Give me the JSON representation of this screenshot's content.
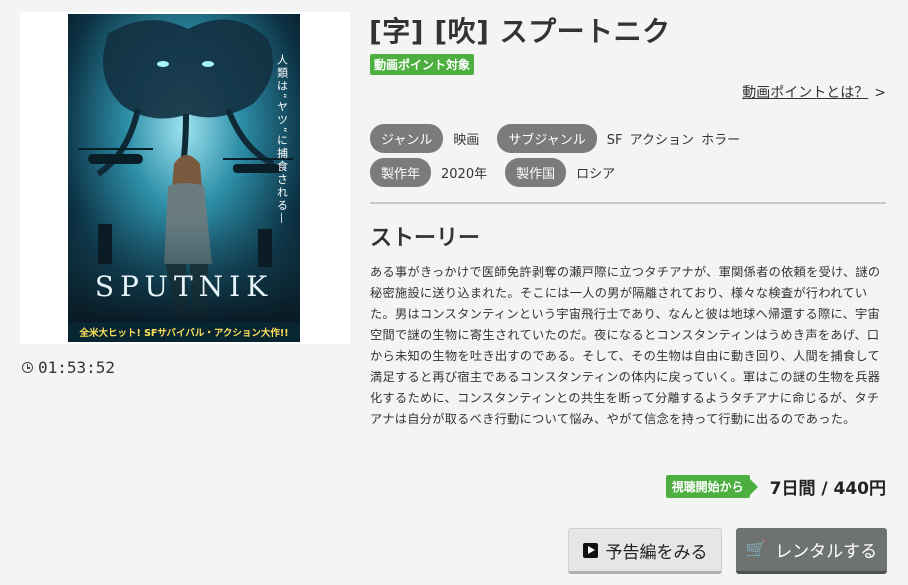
{
  "title": "[字] [吹] スプートニク",
  "point_badge": "動画ポイント対象",
  "point_link": {
    "label": "動画ポイントとは？",
    "chevron": ">"
  },
  "poster": {
    "taglines": [
      "人類は“ヤツ”に捕食される—"
    ],
    "logo": "SPUTNIK",
    "banner": "全米大ヒット! SFサバイバル・アクション大作!!"
  },
  "duration": "01:53:52",
  "meta": {
    "genre_label": "ジャンル",
    "genre_value": "映画",
    "subgenre_label": "サブジャンル",
    "subgenre_value": "SF アクション ホラー",
    "year_label": "製作年",
    "year_value": "2020年",
    "country_label": "製作国",
    "country_value": "ロシア"
  },
  "story": {
    "heading": "ストーリー",
    "text": "ある事がきっかけで医師免許剥奪の瀬戸際に立つタチアナが、軍関係者の依頼を受け、謎の秘密施設に送り込まれた。そこには一人の男が隔離されており、様々な検査が行われていた。男はコンスタンティンという宇宙飛行士であり、なんと彼は地球へ帰還する際に、宇宙空間で謎の生物に寄生されていたのだ。夜になるとコンスタンティンはうめき声をあげ、口から未知の生物を吐き出すのである。そして、その生物は自由に動き回り、人間を捕食して満足すると再び宿主であるコンスタンティンの体内に戻っていく。軍はこの謎の生物を兵器化するために、コンスタンティンとの共生を断って分離するようタチアナに命じるが、タチアナは自分が取るべき行動について悩み、やがて信念を持って行動に出るのであった。"
  },
  "price": {
    "badge": "視聴開始から",
    "text": "7日間 / 440円"
  },
  "buttons": {
    "trailer": "予告編をみる",
    "rental": "レンタルする"
  },
  "colors": {
    "green": "#4caf3f",
    "tag_gray": "#7b7b7b",
    "rental_button": "#6e7370"
  },
  "icons": [
    "clock-icon",
    "play-icon",
    "cart-icon",
    "chevron-right-icon"
  ]
}
